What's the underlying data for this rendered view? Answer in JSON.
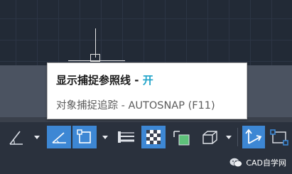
{
  "tooltip": {
    "title": "显示捕捉参照线",
    "separator": " - ",
    "state": "开",
    "subtitle": "对象捕捉追踪 - AUTOSNAP (F11)"
  },
  "statusbar": {
    "buttons": [
      {
        "name": "polar-tracking-icon",
        "active": false
      },
      {
        "name": "snap-to-reference-line-icon",
        "active": true
      },
      {
        "name": "object-snap-icon",
        "active": true
      },
      {
        "name": "lineweight-icon",
        "active": false
      },
      {
        "name": "transparency-icon",
        "active": true
      },
      {
        "name": "selection-cycling-icon",
        "active": false
      },
      {
        "name": "3d-object-snap-icon",
        "active": false
      },
      {
        "name": "dynamic-ucs-icon",
        "active": true
      },
      {
        "name": "annotation-monitor-icon",
        "active": false
      }
    ]
  },
  "watermark": {
    "text": "CAD自学网"
  },
  "colors": {
    "active_button": "#3d87d4",
    "state_on": "#1fa3c9",
    "statusbar_bg": "#2a313d",
    "canvas_bg": "#222a36"
  }
}
